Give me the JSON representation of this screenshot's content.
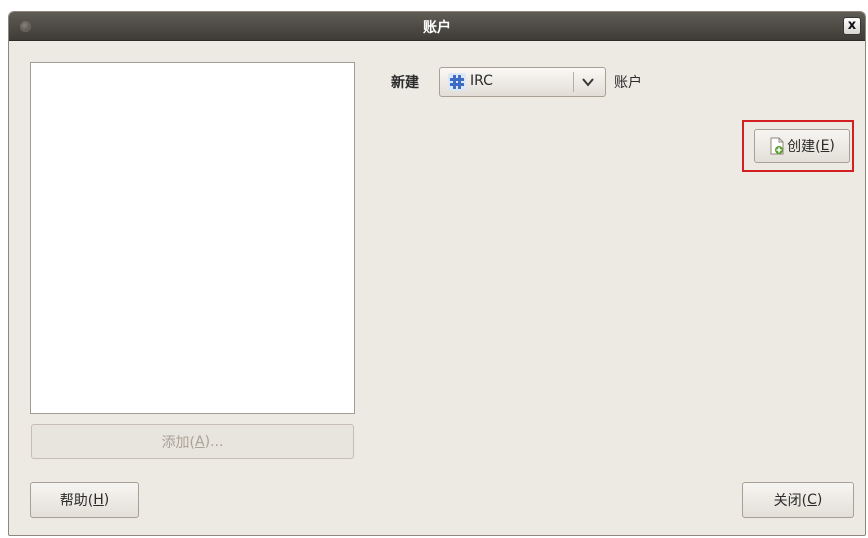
{
  "window": {
    "title": "账户"
  },
  "titlebar": {
    "close_glyph": "x"
  },
  "left": {
    "add_button": {
      "label": "添加(",
      "mnemonic": "A",
      "suffix": ")..."
    }
  },
  "right": {
    "new_label": "新建",
    "protocol_select": {
      "value": "IRC",
      "icon": "irc-hash-icon"
    },
    "account_suffix": "账户",
    "create_button": {
      "label": "创建(",
      "mnemonic": "E",
      "suffix": ")",
      "icon": "document-add-icon"
    }
  },
  "footer": {
    "help_button": {
      "label": "帮助(",
      "mnemonic": "H",
      "suffix": ")"
    },
    "close_button": {
      "label": "关闭(",
      "mnemonic": "C",
      "suffix": ")"
    }
  },
  "colors": {
    "dialog_bg": "#ede9e3",
    "titlebar": "#4a4641",
    "highlight": "#d21f1f",
    "irc_icon": "#3d6cc4"
  }
}
